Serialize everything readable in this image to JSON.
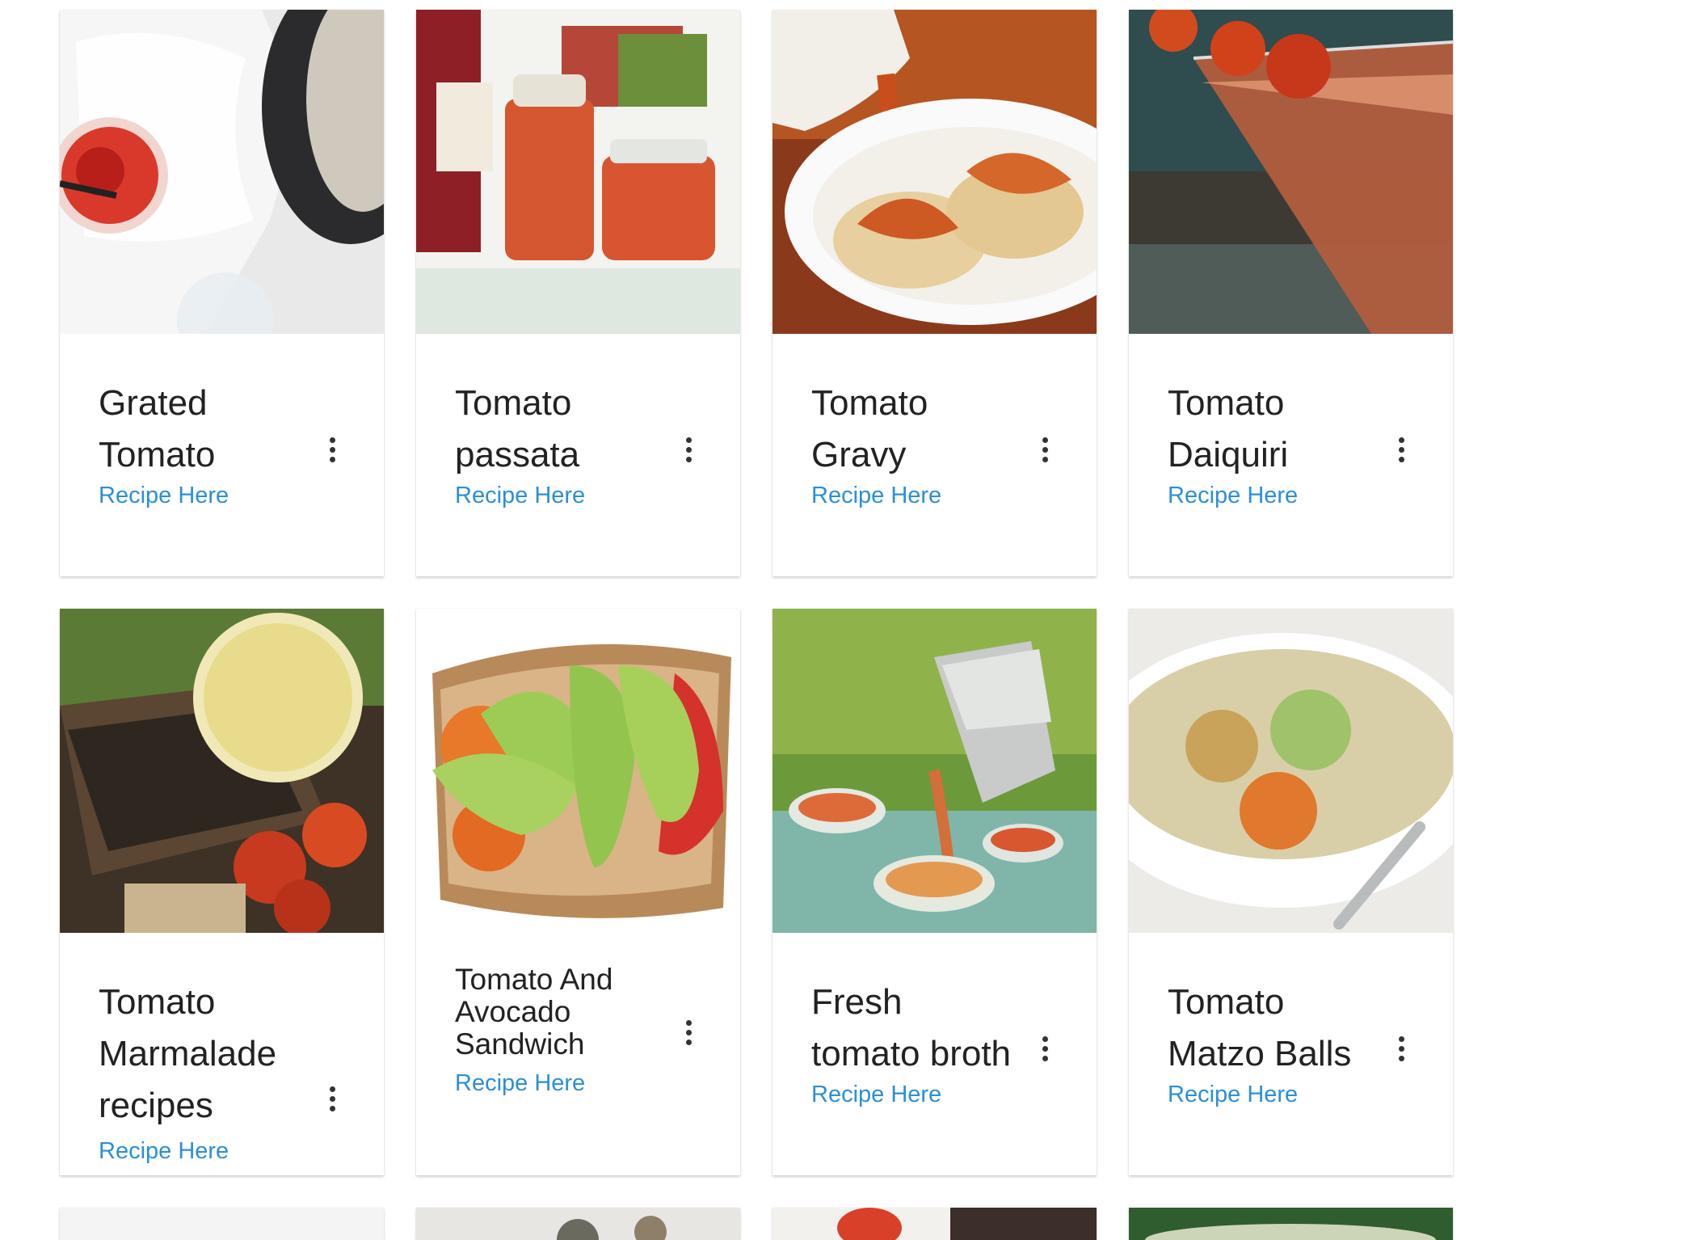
{
  "cards": [
    {
      "title": "Grated Tomato",
      "link": "Recipe Here"
    },
    {
      "title": "Tomato passata",
      "link": "Recipe Here"
    },
    {
      "title": "Tomato Gravy",
      "link": "Recipe Here"
    },
    {
      "title": "Tomato Daiquiri",
      "link": "Recipe Here"
    },
    {
      "title": "Tomato Marmalade recipes",
      "link": "Recipe Here"
    },
    {
      "title": "Tomato And Avocado Sandwich",
      "link": "Recipe Here"
    },
    {
      "title": "Fresh tomato broth",
      "link": "Recipe Here"
    },
    {
      "title": "Tomato Matzo Balls",
      "link": "Recipe Here"
    }
  ],
  "colors": {
    "link": "#2b8fd8",
    "title": "#222222",
    "background": "#ffffff"
  },
  "icons": {
    "menu": "more-vert-icon"
  }
}
